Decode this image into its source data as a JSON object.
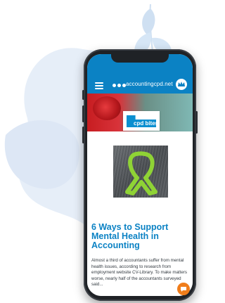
{
  "app_bar": {
    "site_name": "accountingcpd.net",
    "icons": [
      "menu-icon",
      "logo-dots-icon",
      "profile-icon"
    ],
    "colors": {
      "header": "#0b82c4",
      "title": "#0b82c4",
      "chat": "#f07d1b"
    }
  },
  "badge": {
    "label": "cpd bites"
  },
  "article": {
    "title": "6 Ways to Support Mental Health in Accounting",
    "excerpt": "Almost a third of accountants suffer from mental health issues, according to research from employment website CV-Library. To make matters worse, nearly half of the accountants surveyed said..."
  }
}
